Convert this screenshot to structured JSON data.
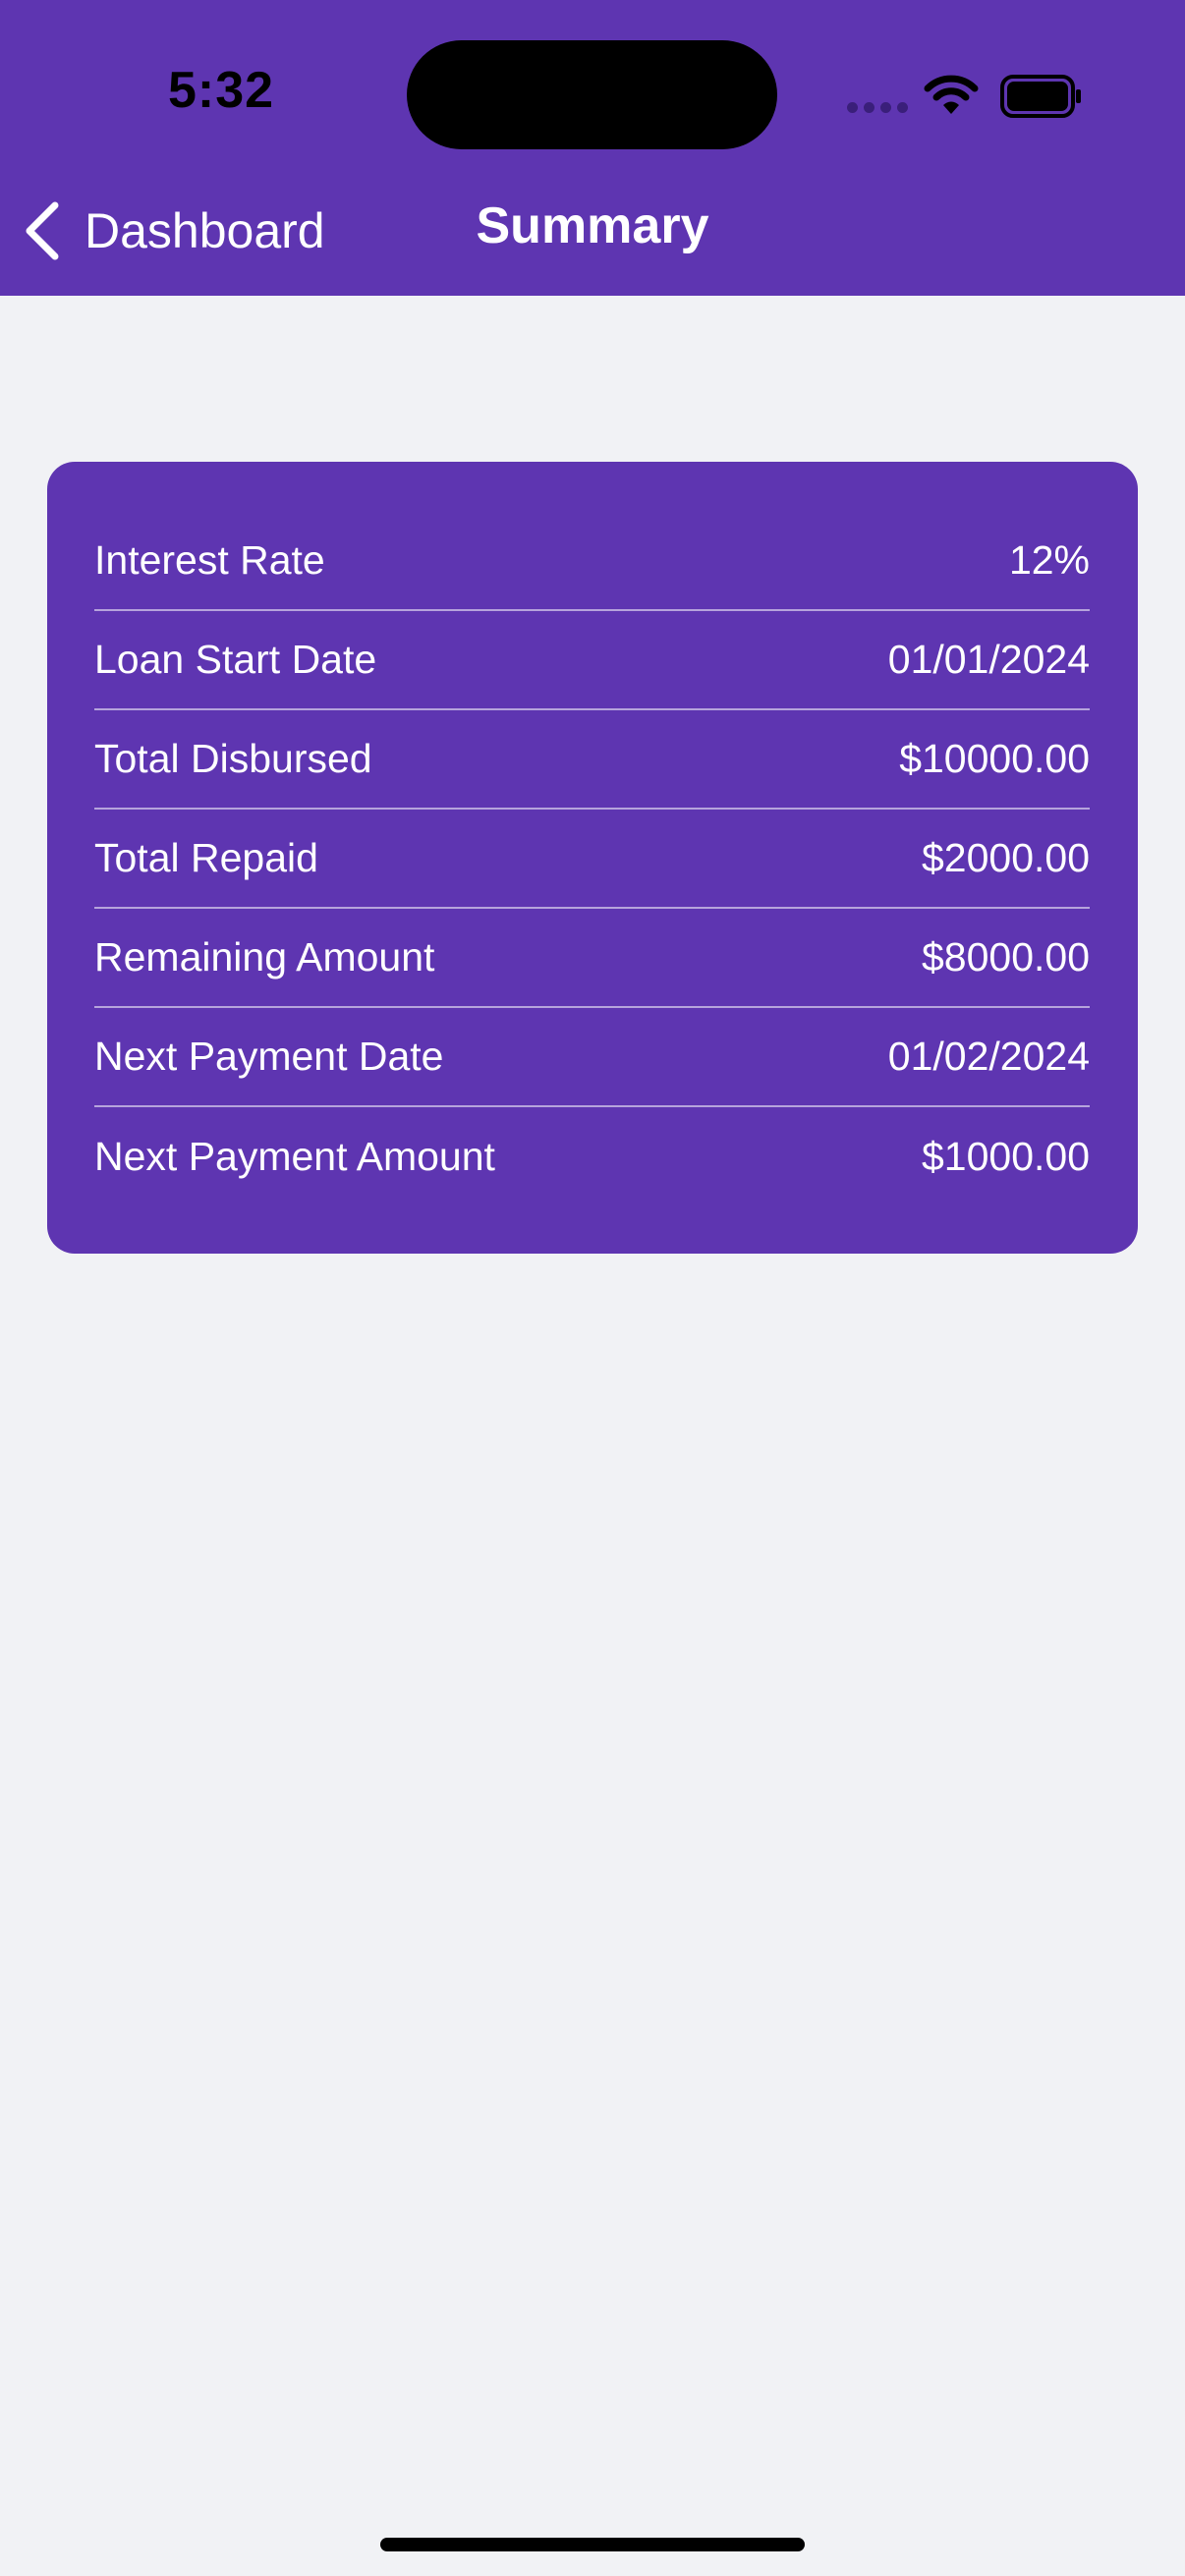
{
  "status_bar": {
    "time": "5:32",
    "icons": [
      "cellular-dots-icon",
      "wifi-icon",
      "battery-icon"
    ]
  },
  "nav": {
    "back_label": "Dashboard",
    "title": "Summary"
  },
  "summary": {
    "rows": [
      {
        "label": "Interest Rate",
        "value": "12%"
      },
      {
        "label": "Loan Start Date",
        "value": "01/01/2024"
      },
      {
        "label": "Total Disbursed",
        "value": "$10000.00"
      },
      {
        "label": "Total Repaid",
        "value": "$2000.00"
      },
      {
        "label": "Remaining Amount",
        "value": "$8000.00"
      },
      {
        "label": "Next Payment Date",
        "value": "01/02/2024"
      },
      {
        "label": "Next Payment Amount",
        "value": "$1000.00"
      }
    ]
  },
  "colors": {
    "brand_purple": "#5E35B1",
    "background": "#F1F2F5",
    "text_on_brand": "#FFFFFF"
  }
}
